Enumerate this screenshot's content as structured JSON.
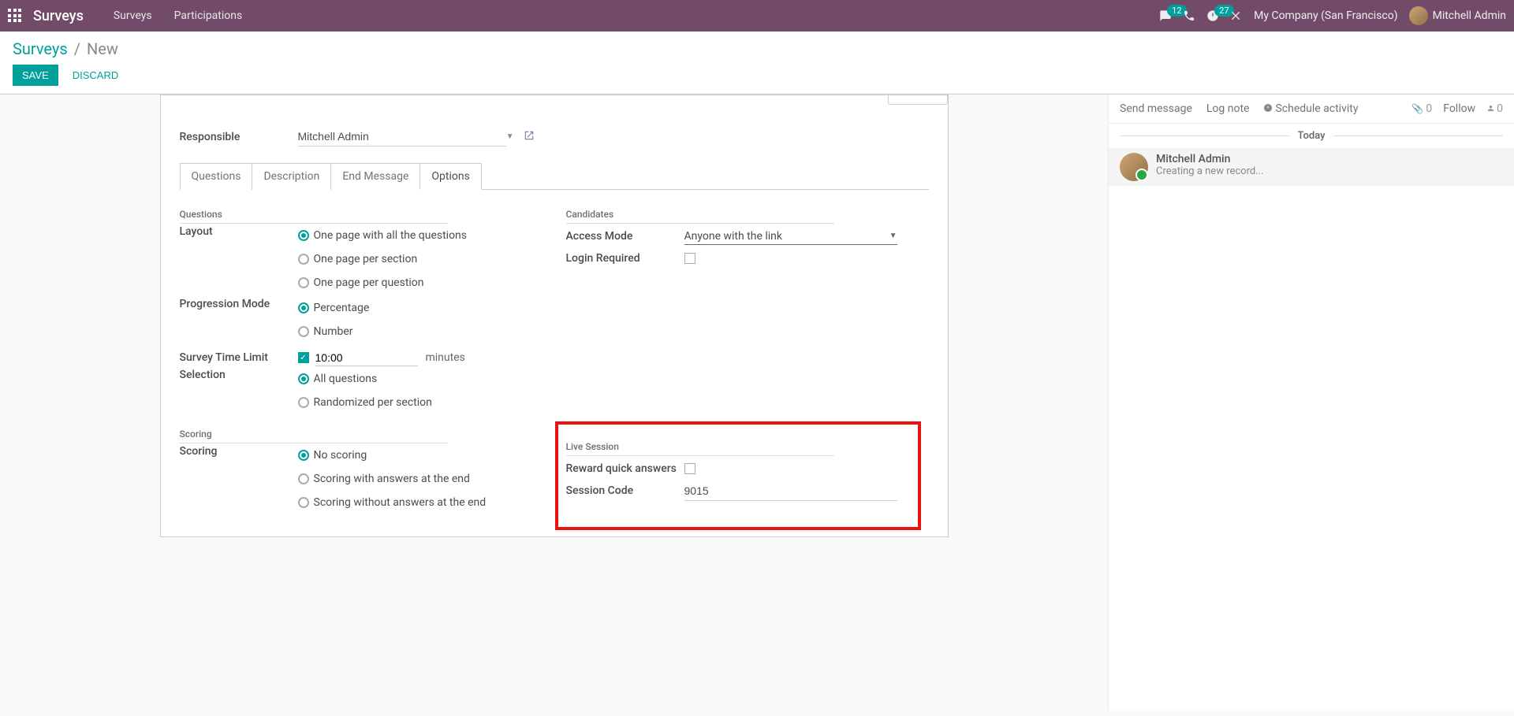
{
  "nav": {
    "brand": "Surveys",
    "items": [
      "Surveys",
      "Participations"
    ],
    "msg_badge": "12",
    "activity_badge": "27",
    "company": "My Company (San Francisco)",
    "user": "Mitchell Admin"
  },
  "breadcrumb": {
    "root": "Surveys",
    "current": "New"
  },
  "buttons": {
    "save": "SAVE",
    "discard": "DISCARD"
  },
  "form": {
    "responsible_label": "Responsible",
    "responsible_value": "Mitchell Admin",
    "tabs": [
      "Questions",
      "Description",
      "End Message",
      "Options"
    ],
    "active_tab": "Options",
    "sections": {
      "questions_title": "Questions",
      "layout_label": "Layout",
      "layout_options": [
        "One page with all the questions",
        "One page per section",
        "One page per question"
      ],
      "progression_label": "Progression Mode",
      "progression_options": [
        "Percentage",
        "Number"
      ],
      "time_limit_label": "Survey Time Limit",
      "time_limit_value": "10:00",
      "time_limit_unit": "minutes",
      "selection_label": "Selection",
      "selection_options": [
        "All questions",
        "Randomized per section"
      ],
      "candidates_title": "Candidates",
      "access_mode_label": "Access Mode",
      "access_mode_value": "Anyone with the link",
      "login_required_label": "Login Required",
      "scoring_title": "Scoring",
      "scoring_label": "Scoring",
      "scoring_options": [
        "No scoring",
        "Scoring with answers at the end",
        "Scoring without answers at the end"
      ],
      "live_title": "Live Session",
      "reward_label": "Reward quick answers",
      "session_code_label": "Session Code",
      "session_code_value": "9015"
    }
  },
  "chatter": {
    "send": "Send message",
    "log": "Log note",
    "schedule": "Schedule activity",
    "attach_count": "0",
    "follow": "Follow",
    "followers": "0",
    "today": "Today",
    "msg_author": "Mitchell Admin",
    "msg_text": "Creating a new record..."
  }
}
